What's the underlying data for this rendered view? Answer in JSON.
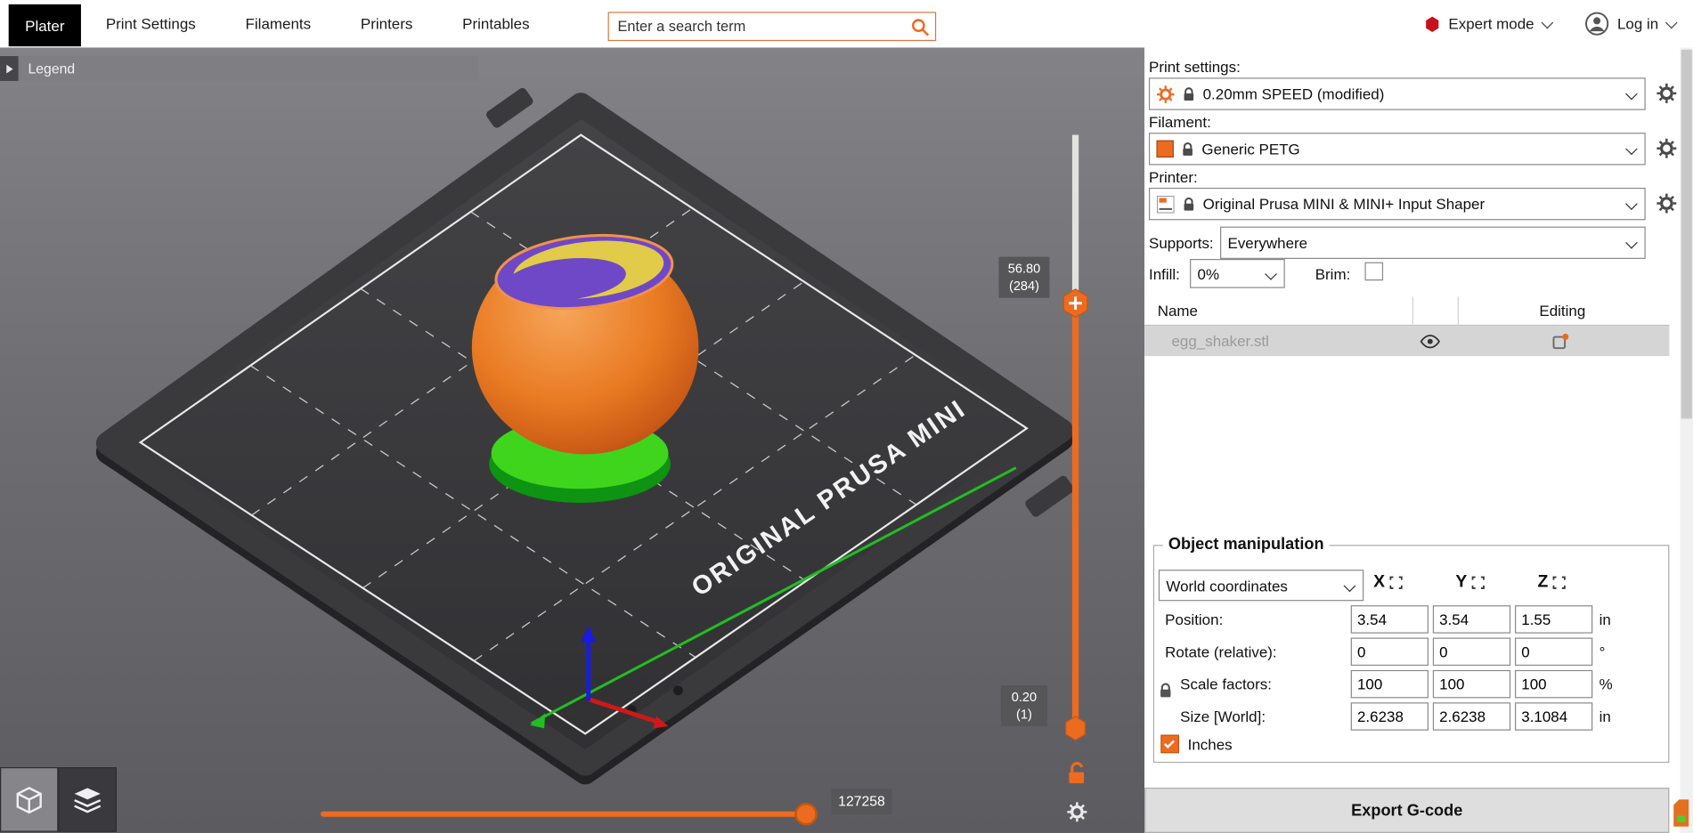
{
  "colors": {
    "accent": "#ED6B21",
    "expert_red": "#C8101A",
    "badge_bg": "#565659",
    "model_orange": "#E8741F",
    "model_purple": "#6F48C8",
    "model_yellow": "#E2CB48",
    "model_green": "#3FD51D",
    "bed_dark": "#3A3A3D",
    "selected_row_bg": "#D5D5D5"
  },
  "topbar": {
    "tabs": [
      {
        "label": "Plater",
        "active": true
      },
      {
        "label": "Print Settings",
        "active": false
      },
      {
        "label": "Filaments",
        "active": false
      },
      {
        "label": "Printers",
        "active": false
      },
      {
        "label": "Printables",
        "active": false
      }
    ],
    "search": {
      "placeholder": "Enter a search term"
    },
    "mode": {
      "label": "Expert mode"
    },
    "account": {
      "label": "Log in"
    }
  },
  "viewport": {
    "legend_label": "Legend",
    "bed_brand": "ORIGINAL PRUSA MINI",
    "layer_slider": {
      "top_value": "56.80",
      "top_layer": "(284)",
      "bottom_value": "0.20",
      "bottom_layer": "(1)"
    },
    "move_slider": {
      "value": "127258"
    }
  },
  "sidebar": {
    "print_settings": {
      "label": "Print settings:",
      "value": "0.20mm SPEED (modified)"
    },
    "filament": {
      "label": "Filament:",
      "value": "Generic PETG"
    },
    "printer": {
      "label": "Printer:",
      "value": "Original Prusa MINI & MINI+ Input Shaper"
    },
    "supports": {
      "label": "Supports:",
      "value": "Everywhere"
    },
    "infill": {
      "label": "Infill:",
      "value": "0%"
    },
    "brim": {
      "label": "Brim:",
      "checked": false
    },
    "object_list": {
      "name_header": "Name",
      "editing_header": "Editing",
      "rows": [
        {
          "name": "egg_shaker.stl"
        }
      ]
    },
    "manipulation": {
      "title": "Object manipulation",
      "coordinates": "World coordinates",
      "axes": [
        "X",
        "Y",
        "Z"
      ],
      "rows": [
        {
          "label": "Position:",
          "x": "3.54",
          "y": "3.54",
          "z": "1.55",
          "unit": "in"
        },
        {
          "label": "Rotate (relative):",
          "x": "0",
          "y": "0",
          "z": "0",
          "unit": "°"
        },
        {
          "label": "Scale factors:",
          "x": "100",
          "y": "100",
          "z": "100",
          "unit": "%"
        },
        {
          "label": "Size [World]:",
          "x": "2.6238",
          "y": "2.6238",
          "z": "3.1084",
          "unit": "in"
        }
      ],
      "inches": {
        "label": "Inches",
        "checked": true
      }
    },
    "export": {
      "label": "Export G-code"
    }
  }
}
